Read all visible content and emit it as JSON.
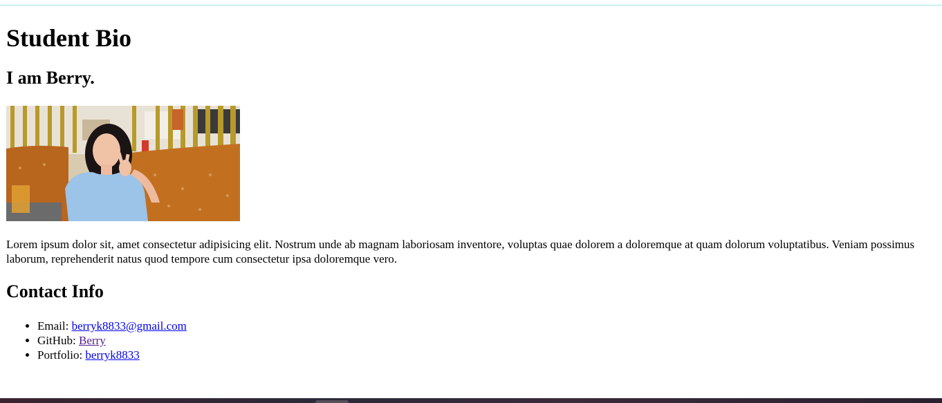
{
  "page": {
    "title": "Student Bio",
    "intro": "I am Berry.",
    "bio": "Lorem ipsum dolor sit, amet consectetur adipisicing elit. Nostrum unde ab magnam laboriosam inventore, voluptas quae dolorem a doloremque at quam dolorum voluptatibus. Veniam possimus laborum, reprehenderit natus quod tempore cum consectetur ipsa doloremque vero.",
    "contact_heading": "Contact Info"
  },
  "contact": {
    "email_label": "Email: ",
    "email_link": "berryk8833@gmail.com",
    "github_label": "GitHub: ",
    "github_link": "Berry",
    "portfolio_label": "Portfolio: ",
    "portfolio_link": "berryk8833"
  },
  "colors": {
    "link": "#0000ee",
    "visited_link": "#551a8b",
    "top_border": "#9fe3e8"
  }
}
